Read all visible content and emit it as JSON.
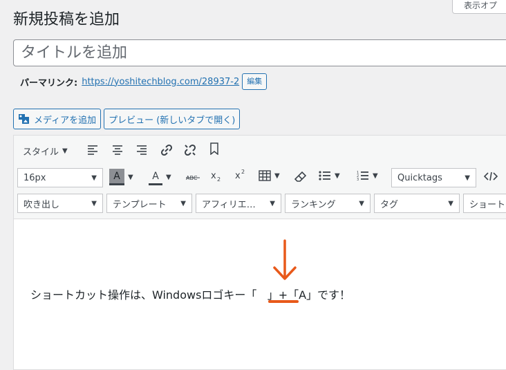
{
  "header": {
    "screen_options": "表示オプ",
    "page_title": "新規投稿を追加"
  },
  "title_input": {
    "placeholder": "タイトルを追加"
  },
  "permalink": {
    "label": "パーマリンク:",
    "url": "https://yoshitechblog.com/28937-2",
    "edit_label": "編集"
  },
  "media_buttons": {
    "add_media": "メディアを追加",
    "preview": "プレビュー (新しいタブで開く)"
  },
  "toolbar": {
    "style_label": "スタイル",
    "font_size": "16px",
    "quicktags": "Quicktags",
    "row3": {
      "speech_bubble": "吹き出し",
      "template": "テンプレート",
      "affiliate": "アフィリエ…",
      "ranking": "ランキング",
      "tag": "タグ",
      "shortcode": "ショート"
    }
  },
  "content": {
    "text_before": "ショートカット操作は、Windowsロゴキー「",
    "text_after": "」+「A」です！"
  },
  "colors": {
    "accent": "#2271b1",
    "annotation": "#e8591a"
  }
}
